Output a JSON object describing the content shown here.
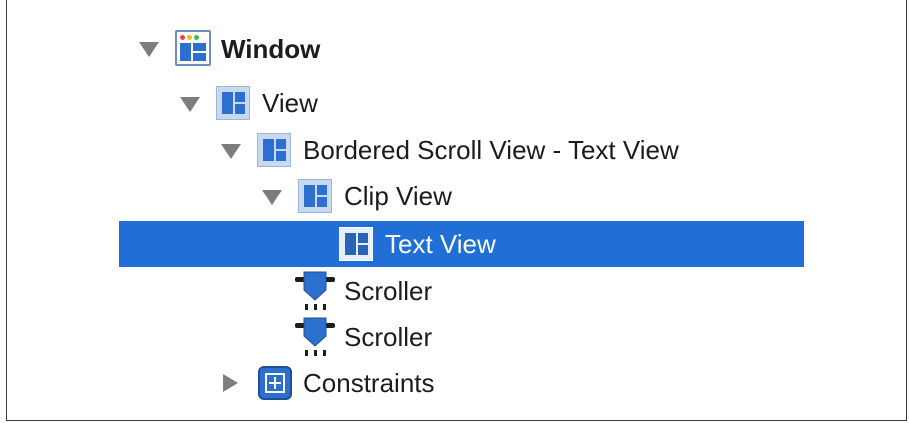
{
  "tree": {
    "items": [
      {
        "label": "Window",
        "icon": "window-icon",
        "expanded": true
      },
      {
        "label": "View",
        "icon": "view-icon",
        "expanded": true
      },
      {
        "label": "Bordered Scroll View - Text View",
        "icon": "view-icon",
        "expanded": true
      },
      {
        "label": "Clip View",
        "icon": "view-icon",
        "expanded": true
      },
      {
        "label": "Text View",
        "icon": "view-icon",
        "selected": true
      },
      {
        "label": "Scroller",
        "icon": "scroller-icon"
      },
      {
        "label": "Scroller",
        "icon": "scroller-icon"
      },
      {
        "label": "Constraints",
        "icon": "constraints-icon",
        "expanded": false
      }
    ]
  },
  "colors": {
    "selection": "#1f6fd6",
    "icon_blue": "#2d6fce",
    "disclosure": "#7d7d7d"
  }
}
